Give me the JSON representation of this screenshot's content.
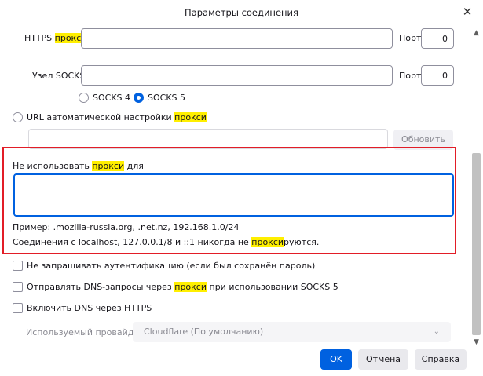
{
  "window": {
    "title": "Параметры соединения"
  },
  "https": {
    "label_pre": "HTTPS ",
    "label_hl": "прокси",
    "port_label": "Порт",
    "port_value": "0"
  },
  "socks": {
    "label": "Узел SOCKS",
    "port_label": "Порт",
    "port_value": "0",
    "v4": "SOCKS 4",
    "v5": "SOCKS 5",
    "selected": "v5"
  },
  "autoconf": {
    "label_pre": "URL автоматической настройки ",
    "label_hl": "прокси",
    "url_value": "",
    "refresh_label": "Обновить"
  },
  "no_proxy": {
    "label_pre": "Не использовать ",
    "label_hl": "прокси",
    "label_post": " для",
    "value": "",
    "example": "Пример: .mozilla-russia.org, .net.nz, 192.168.1.0/24",
    "localhost_pre": "Соединения с localhost, 127.0.0.1/8 и ::1 никогда не ",
    "localhost_hl": "прокси",
    "localhost_post": "руются."
  },
  "options": {
    "no_auth": "Не запрашивать аутентификацию (если был сохранён пароль)",
    "dns_pre": "Отправлять DNS-запросы через ",
    "dns_hl": "прокси",
    "dns_post": " при использовании SOCKS 5",
    "doh": "Включить DNS через HTTPS"
  },
  "provider": {
    "label": "Используемый провайдер",
    "value": "Cloudflare (По умолчанию)"
  },
  "buttons": {
    "ok": "OK",
    "cancel": "Отмена",
    "help": "Справка"
  }
}
